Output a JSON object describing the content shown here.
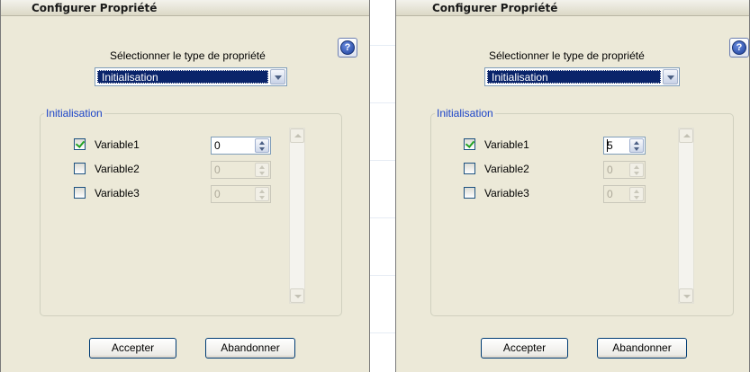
{
  "dialogs": [
    {
      "title": "Configurer Propriété",
      "prompt": "Sélectionner le type de propriété",
      "type_select": {
        "value": "Initialisation"
      },
      "group": {
        "legend": "Initialisation",
        "variables": [
          {
            "name": "Variable1",
            "checked": true,
            "value": "0",
            "enabled": true
          },
          {
            "name": "Variable2",
            "checked": false,
            "value": "0",
            "enabled": false
          },
          {
            "name": "Variable3",
            "checked": false,
            "value": "0",
            "enabled": false
          }
        ]
      },
      "buttons": {
        "accept": "Accepter",
        "cancel": "Abandonner"
      }
    },
    {
      "title": "Configurer Propriété",
      "prompt": "Sélectionner le type de propriété",
      "type_select": {
        "value": "Initialisation"
      },
      "group": {
        "legend": "Initialisation",
        "variables": [
          {
            "name": "Variable1",
            "checked": true,
            "value": "5",
            "enabled": true
          },
          {
            "name": "Variable2",
            "checked": false,
            "value": "0",
            "enabled": false
          },
          {
            "name": "Variable3",
            "checked": false,
            "value": "0",
            "enabled": false
          }
        ]
      },
      "buttons": {
        "accept": "Accepter",
        "cancel": "Abandonner"
      }
    }
  ],
  "icons": {
    "help": "help-question-icon",
    "dropdown": "chevron-down-icon",
    "spinner": "spin-up-down-icon"
  },
  "colors": {
    "selection": "#0a246a",
    "legend": "#1a43c8",
    "dialog_bg": "#ece9d8"
  }
}
